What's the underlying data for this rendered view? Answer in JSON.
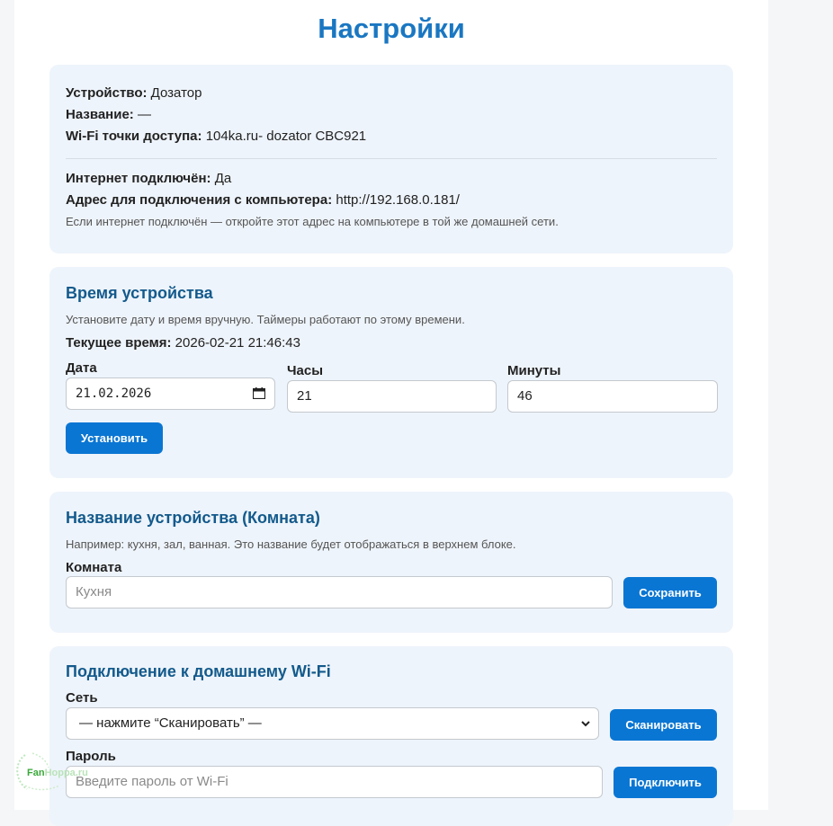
{
  "header": {
    "title": "Настройки"
  },
  "info": {
    "device_label": "Устройство:",
    "device_value": "Дозатор",
    "name_label": "Название:",
    "name_value": "—",
    "ap_label": "Wi-Fi точки доступа:",
    "ap_value": "104ka.ru- dozator CBC921",
    "internet_label": "Интернет подключён:",
    "internet_value": "Да",
    "address_label": "Адрес для подключения с компьютера:",
    "address_value": "http://192.168.0.181/",
    "hint": "Если интернет подключён — откройте этот адрес на компьютере в той же домашней сети."
  },
  "time": {
    "title": "Время устройства",
    "hint": "Установите дату и время вручную. Таймеры работают по этому времени.",
    "current_label": "Текущее время:",
    "current_value": "2026-02-21 21:46:43",
    "date_label": "Дата",
    "date_value": "21.02.2026",
    "hours_label": "Часы",
    "hours_value": "21",
    "minutes_label": "Минуты",
    "minutes_value": "46",
    "set_button": "Установить"
  },
  "room": {
    "title": "Название устройства (Комната)",
    "hint": "Например: кухня, зал, ванная. Это название будет отображаться в верхнем блоке.",
    "field_label": "Комната",
    "placeholder": "Кухня",
    "save_button": "Сохранить"
  },
  "wifi": {
    "title": "Подключение к домашнему Wi-Fi",
    "network_label": "Сеть",
    "network_selected": "— нажмите “Сканировать” —",
    "scan_button": "Сканировать",
    "password_label": "Пароль",
    "password_placeholder": "Введите пароль от Wi-Fi",
    "connect_button": "Подключить"
  },
  "watermark": {
    "text_a": "Fan",
    "text_b": "Hoppa.ru"
  },
  "colors": {
    "accent": "#0a76d3",
    "title": "#1a77c2",
    "card_bg": "#eef4fb",
    "heading": "#135a8c"
  }
}
